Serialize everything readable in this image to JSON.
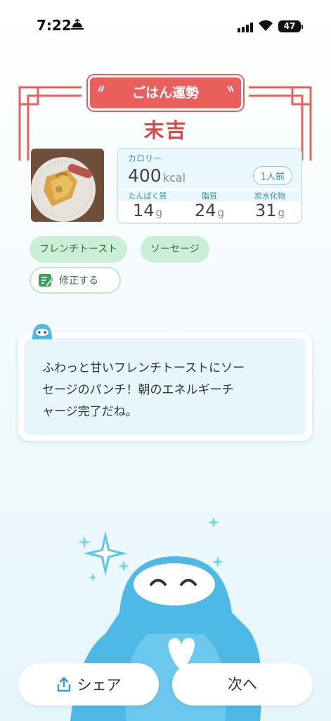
{
  "status_bar": {
    "time": "7:22",
    "battery": "47"
  },
  "header": {
    "banner": "ごはん運勢",
    "fortune": "末吉"
  },
  "nutrition": {
    "calorie_label": "カロリー",
    "calorie_value": "400",
    "calorie_unit": "kcal",
    "portion": "1人前",
    "protein_label": "たんぱく質",
    "protein_value": "14",
    "fat_label": "脂質",
    "fat_value": "24",
    "carb_label": "炭水化物",
    "carb_value": "31",
    "gram_unit": "g"
  },
  "tags": [
    "フレンチトースト",
    "ソーセージ"
  ],
  "edit_label": "修正する",
  "message": [
    "ふわっと甘いフレンチトーストにソー",
    "セージのパンチ！朝のエネルギーチ",
    "ャージ完了だね。"
  ],
  "buttons": {
    "share": "シェア",
    "next": "次へ"
  },
  "colors": {
    "accent_red": "#e85f5b",
    "accent_blue": "#2f8fb3",
    "tag_green": "#cdeed6",
    "mascot_blue": "#4fb9e6"
  }
}
